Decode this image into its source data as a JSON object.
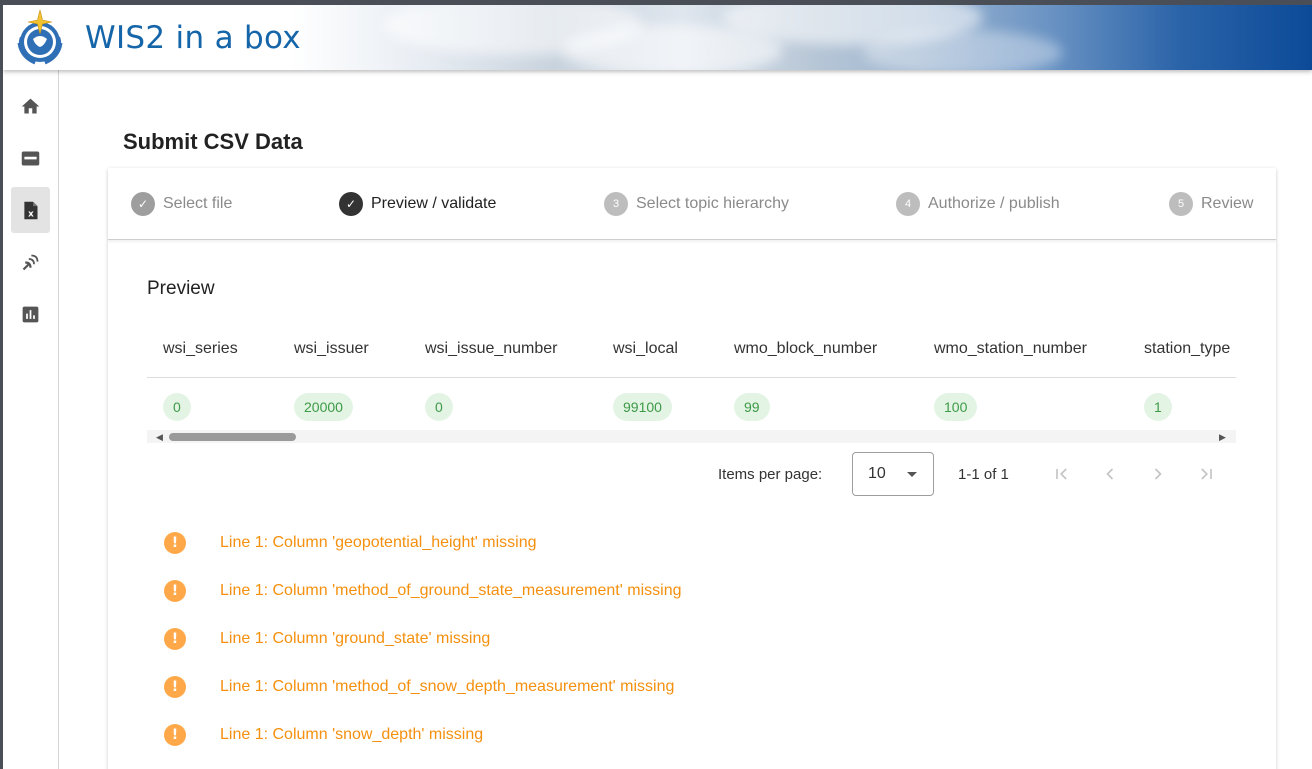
{
  "header": {
    "title": "WIS2 in a box"
  },
  "sidebar": {
    "items": [
      {
        "icon": "home-icon"
      },
      {
        "icon": "card-icon"
      },
      {
        "icon": "excel-file-icon"
      },
      {
        "icon": "satellite-dish-icon"
      },
      {
        "icon": "bar-chart-icon"
      }
    ]
  },
  "page": {
    "title": "Submit CSV Data"
  },
  "stepper": {
    "steps": [
      {
        "label": "Select file",
        "marker": "✓",
        "state": "done"
      },
      {
        "label": "Preview / validate",
        "marker": "✓",
        "state": "current"
      },
      {
        "label": "Select topic hierarchy",
        "marker": "3",
        "state": "pending"
      },
      {
        "label": "Authorize / publish",
        "marker": "4",
        "state": "pending"
      },
      {
        "label": "Review",
        "marker": "5",
        "state": "pending"
      }
    ]
  },
  "preview": {
    "title": "Preview",
    "columns": [
      "wsi_series",
      "wsi_issuer",
      "wsi_issue_number",
      "wsi_local",
      "wmo_block_number",
      "wmo_station_number",
      "station_type"
    ],
    "rows": [
      [
        "0",
        "20000",
        "0",
        "99100",
        "99",
        "100",
        "1"
      ]
    ]
  },
  "paginator": {
    "items_per_page_label": "Items per page:",
    "page_size": "10",
    "range_label": "1-1 of 1"
  },
  "errors": [
    "Line 1: Column 'geopotential_height' missing",
    "Line 1: Column 'method_of_ground_state_measurement' missing",
    "Line 1: Column 'ground_state' missing",
    "Line 1: Column 'method_of_snow_depth_measurement' missing",
    "Line 1: Column 'snow_depth' missing"
  ],
  "colors": {
    "brand_blue": "#1565a9",
    "error_orange": "#f5900e",
    "chip_green": "#3d9a46"
  }
}
